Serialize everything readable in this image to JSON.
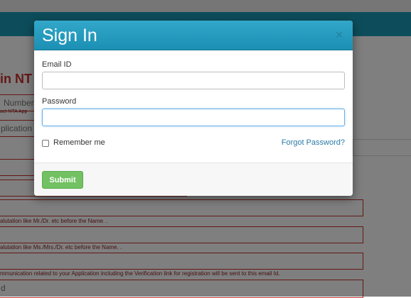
{
  "background": {
    "heading": "in NT",
    "number_field": "Number",
    "nta_hint": "act NTA App",
    "application_field": "plication",
    "salutation_hint_1": "alutation like Mr./Dr. etc before the Name. .",
    "salutation_hint_2": "alutation like Ms./Mrs./Dr. etc before the Name. .",
    "email_hint": "mmunication related to your Application including the Verification link for registration will be sent to this email Id.",
    "last_field": "d"
  },
  "modal": {
    "title": "Sign In",
    "close_symbol": "×",
    "email_label": "Email ID",
    "email_value": "",
    "password_label": "Password",
    "password_value": "",
    "remember_label": "Remember me",
    "remember_checked": false,
    "forgot_link": "Forgot Password?",
    "submit_label": "Submit"
  },
  "colors": {
    "header_teal": "#1b9ab7",
    "modal_header": "#2a9cc2",
    "submit_green": "#72c162",
    "link_blue": "#2a7aa6",
    "error_red": "#c9302c"
  }
}
